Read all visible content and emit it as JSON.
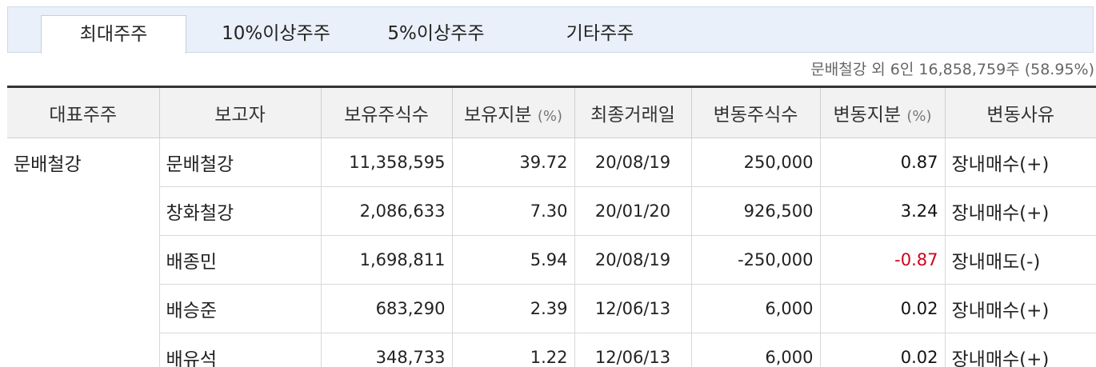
{
  "tabs": [
    {
      "label": "최대주주",
      "active": true
    },
    {
      "label": "10%이상주주",
      "active": false
    },
    {
      "label": "5%이상주주",
      "active": false
    },
    {
      "label": "기타주주",
      "active": false
    }
  ],
  "summary": "문배철강 외 6인  16,858,759주 (58.95%)",
  "table": {
    "headers": {
      "rep": "대표주주",
      "reporter": "보고자",
      "shares": "보유주식수",
      "stake": "보유지분",
      "stake_unit": "(%)",
      "last_date": "최종거래일",
      "change_shares": "변동주식수",
      "change_stake": "변동지분",
      "change_stake_unit": "(%)",
      "reason": "변동사유"
    },
    "rep_name": "문배철강",
    "rows": [
      {
        "reporter": "문배철강",
        "shares": "11,358,595",
        "stake": "39.72",
        "date": "20/08/19",
        "change_shares": "250,000",
        "change_stake": "0.87",
        "reason": "장내매수(+)"
      },
      {
        "reporter": "창화철강",
        "shares": "2,086,633",
        "stake": "7.30",
        "date": "20/01/20",
        "change_shares": "926,500",
        "change_stake": "3.24",
        "reason": "장내매수(+)"
      },
      {
        "reporter": "배종민",
        "shares": "1,698,811",
        "stake": "5.94",
        "date": "20/08/19",
        "change_shares": "-250,000",
        "change_stake": "-0.87",
        "reason": "장내매도(-)"
      },
      {
        "reporter": "배승준",
        "shares": "683,290",
        "stake": "2.39",
        "date": "12/06/13",
        "change_shares": "6,000",
        "change_stake": "0.02",
        "reason": "장내매수(+)"
      },
      {
        "reporter": "배유석",
        "shares": "348,733",
        "stake": "1.22",
        "date": "12/06/13",
        "change_shares": "6,000",
        "change_stake": "0.02",
        "reason": "장내매수(+)"
      }
    ]
  },
  "colors": {
    "negative": "#d0021b",
    "header_bg": "#f2f2f2",
    "tabbar_bg": "#e9f0fa"
  }
}
